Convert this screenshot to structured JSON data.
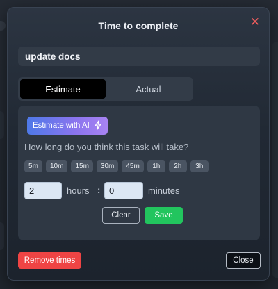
{
  "dialog": {
    "title": "Time to complete",
    "close_icon": "close-icon"
  },
  "task": {
    "name": "update docs"
  },
  "tabs": [
    {
      "label": "Estimate",
      "active": true
    },
    {
      "label": "Actual",
      "active": false
    }
  ],
  "estimate": {
    "ai_button_label": "Estimate with AI",
    "ai_icon": "lightning-icon",
    "question": "How long do you think this task will take?",
    "presets": [
      "5m",
      "10m",
      "15m",
      "30m",
      "45m",
      "1h",
      "2h",
      "3h"
    ],
    "hours_value": "2",
    "hours_label": "hours",
    "separator": ":",
    "minutes_value": "0",
    "minutes_label": "minutes",
    "clear_label": "Clear",
    "save_label": "Save"
  },
  "footer": {
    "remove_label": "Remove times",
    "close_label": "Close"
  },
  "colors": {
    "save": "#22c55e",
    "remove": "#ef4444",
    "close_x": "#ef5d5d",
    "ai_gradient_start": "#4e79e8",
    "ai_gradient_end": "#a883f2"
  }
}
